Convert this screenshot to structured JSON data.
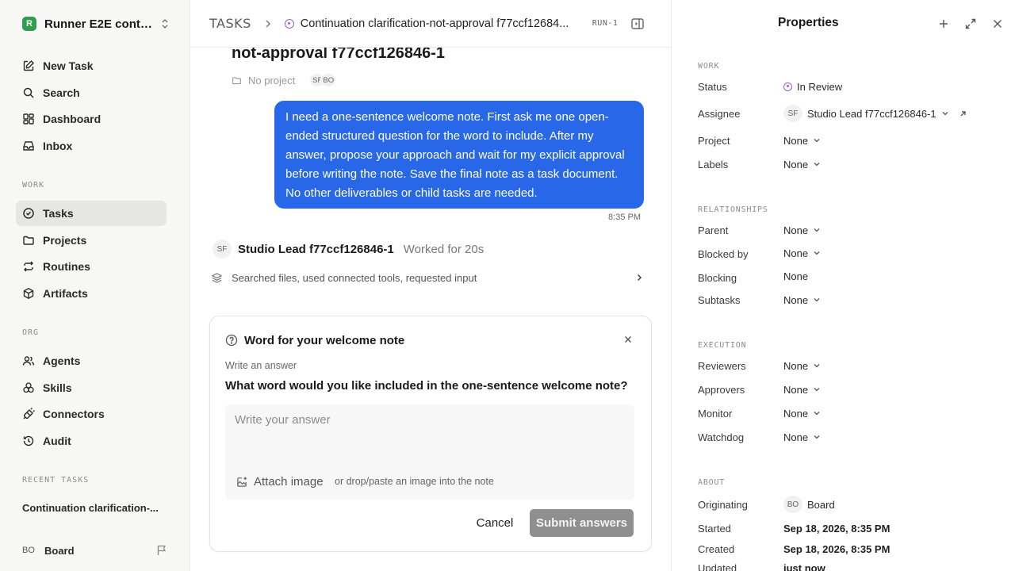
{
  "sidebar": {
    "workspace": {
      "logo": "R",
      "name": "Runner E2E conti..."
    },
    "top_items": [
      {
        "label": "New Task",
        "icon": "edit-icon"
      },
      {
        "label": "Search",
        "icon": "search-icon"
      },
      {
        "label": "Dashboard",
        "icon": "dashboard-icon"
      },
      {
        "label": "Inbox",
        "icon": "inbox-icon"
      }
    ],
    "work_section": "WORK",
    "work_items": [
      {
        "label": "Tasks",
        "icon": "check-circle-icon",
        "active": true
      },
      {
        "label": "Projects",
        "icon": "folder-icon"
      },
      {
        "label": "Routines",
        "icon": "repeat-icon"
      },
      {
        "label": "Artifacts",
        "icon": "box-icon"
      }
    ],
    "org_section": "ORG",
    "org_items": [
      {
        "label": "Agents",
        "icon": "users-icon"
      },
      {
        "label": "Skills",
        "icon": "skills-icon"
      },
      {
        "label": "Connectors",
        "icon": "plug-icon"
      },
      {
        "label": "Audit",
        "icon": "history-icon"
      }
    ],
    "recent_section": "RECENT TASKS",
    "recent_items": [
      "Continuation clarification-..."
    ],
    "user": {
      "initials": "BO",
      "name": "Board"
    }
  },
  "header": {
    "root": "TASKS",
    "title": "Continuation clarification-not-approval f77ccf12684...",
    "run_badge": "RUN-1"
  },
  "task": {
    "title": "not-approval f77ccf126846-1",
    "project": "No project",
    "avatars": [
      "SF",
      "BO"
    ]
  },
  "message": {
    "text": "I need a one-sentence welcome note. First ask me one open-ended structured question for the word to include. After my answer, propose your approach and wait for my explicit approval before writing the note. Save the final note as a task document. No other deliverables or child tasks are needed.",
    "time": "8:35 PM"
  },
  "agent": {
    "initials": "SF",
    "name": "Studio Lead f77ccf126846-1",
    "worked": "Worked for 20s",
    "activity": "Searched files, used connected tools, requested input"
  },
  "question_card": {
    "title": "Word for your welcome note",
    "subtitle": "Write an answer",
    "question": "What word would you like included in the one-sentence welcome note?",
    "placeholder": "Write your answer",
    "attach_label": "Attach image",
    "drop_hint": "or drop/paste an image into the note",
    "cancel_label": "Cancel",
    "submit_label": "Submit answers"
  },
  "properties": {
    "title": "Properties",
    "work_section": "WORK",
    "status_label": "Status",
    "status_value": "In Review",
    "status_color": "#a05bd6",
    "assignee_label": "Assignee",
    "assignee_initials": "SF",
    "assignee_value": "Studio Lead f77ccf126846-1",
    "project_label": "Project",
    "project_value": "None",
    "labels_label": "Labels",
    "labels_value": "None",
    "relationships_section": "RELATIONSHIPS",
    "parent_label": "Parent",
    "parent_value": "None",
    "blocked_by_label": "Blocked by",
    "blocked_by_value": "None",
    "blocking_label": "Blocking",
    "blocking_value": "None",
    "subtasks_label": "Subtasks",
    "subtasks_value": "None",
    "execution_section": "EXECUTION",
    "reviewers_label": "Reviewers",
    "reviewers_value": "None",
    "approvers_label": "Approvers",
    "approvers_value": "None",
    "monitor_label": "Monitor",
    "monitor_value": "None",
    "watchdog_label": "Watchdog",
    "watchdog_value": "None",
    "about_section": "ABOUT",
    "originating_label": "Originating",
    "originating_initials": "BO",
    "originating_value": "Board",
    "started_label": "Started",
    "started_value": "Sep 18, 2026, 8:35 PM",
    "created_label": "Created",
    "created_value": "Sep 18, 2026, 8:35 PM",
    "updated_label": "Updated",
    "updated_value": "just now"
  },
  "colors": {
    "accent": "#2868e8",
    "submit_disabled": "#8f8f8f"
  }
}
